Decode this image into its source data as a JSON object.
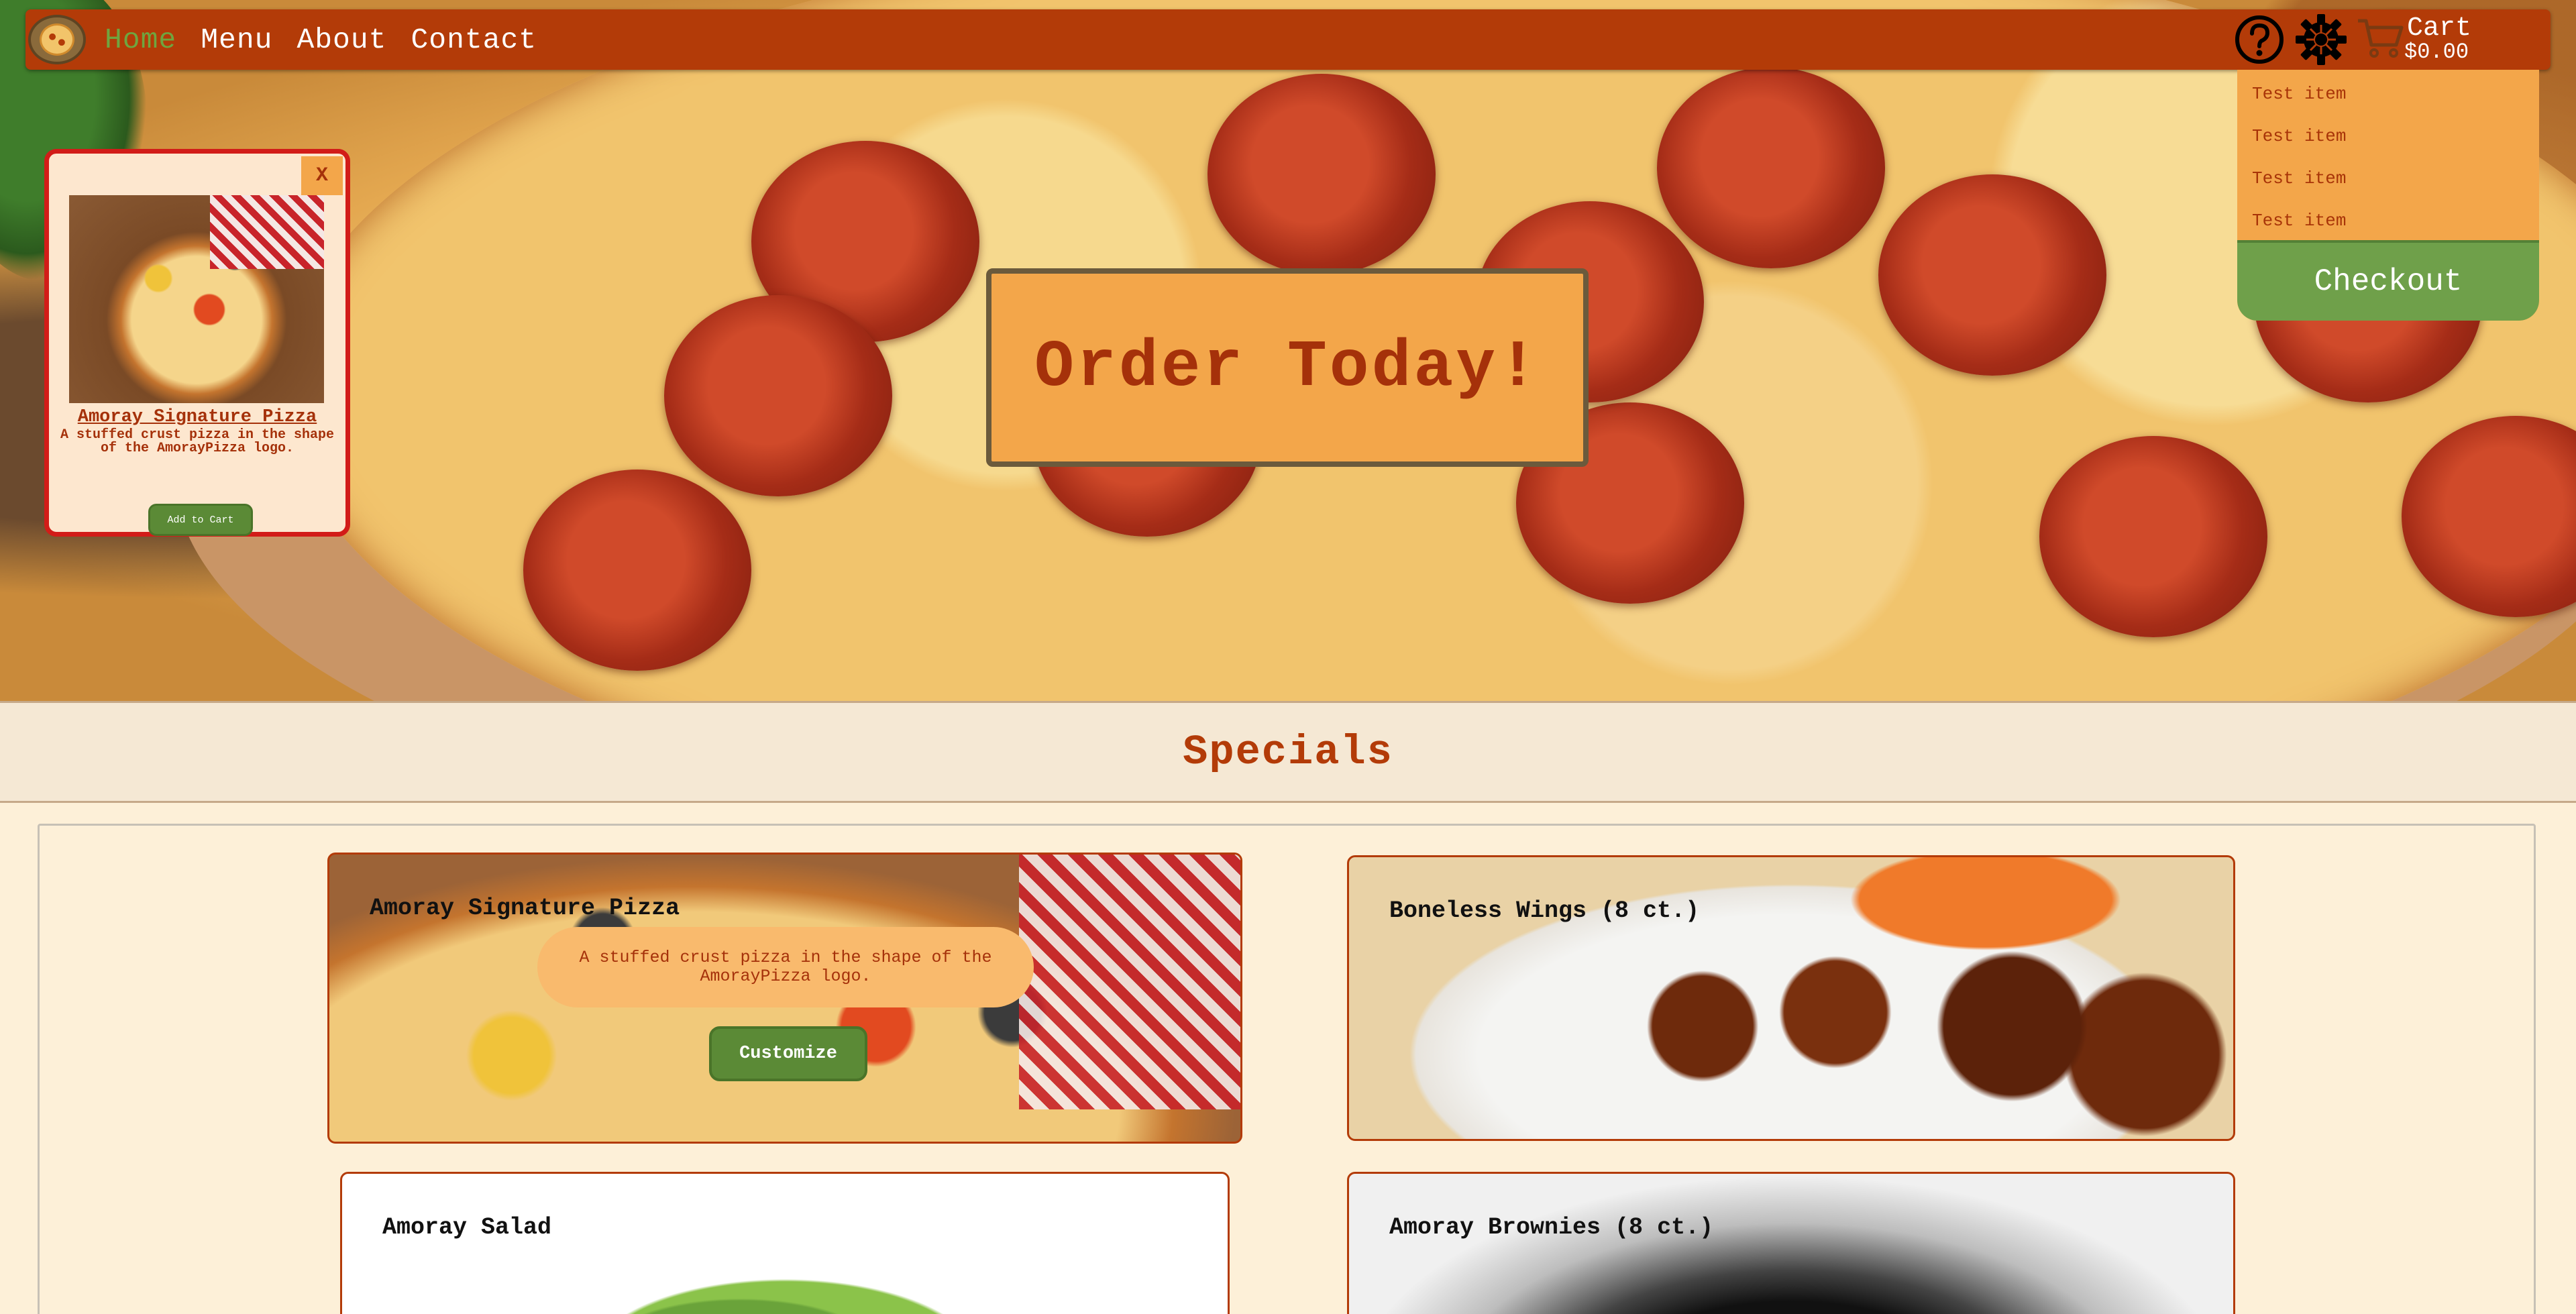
{
  "nav": {
    "links": [
      {
        "label": "Home",
        "active": true
      },
      {
        "label": "Menu"
      },
      {
        "label": "About"
      },
      {
        "label": "Contact"
      }
    ],
    "cart_label": "Cart",
    "cart_total": "$0.00",
    "icons": [
      "logo-icon",
      "help-icon",
      "settings-icon",
      "cart-icon"
    ]
  },
  "cart_dropdown": {
    "items": [
      "Test item",
      "Test item",
      "Test item",
      "Test item"
    ],
    "checkout_label": "Checkout"
  },
  "hero": {
    "cta_label": "Order Today!"
  },
  "popup": {
    "close_label": "X",
    "title": "Amoray Signature Pizza",
    "description": "A stuffed crust pizza in the shape of the AmorayPizza logo.",
    "add_label": "Add to Cart"
  },
  "specials": {
    "title": "Specials",
    "cards": [
      {
        "title": "Amoray Signature Pizza",
        "description": "A stuffed crust pizza in the shape of the AmorayPizza logo.",
        "button_label": "Customize"
      },
      {
        "title": "Boneless Wings (8 ct.)"
      },
      {
        "title": "Amoray Salad"
      },
      {
        "title": "Amoray Brownies (8 ct.)"
      }
    ]
  },
  "colors": {
    "brand": "#b33b08",
    "accent": "#f3a64a",
    "button_green": "#5b8a36",
    "active_link": "#6fa53f",
    "page_bg": "#fdf0d8"
  }
}
